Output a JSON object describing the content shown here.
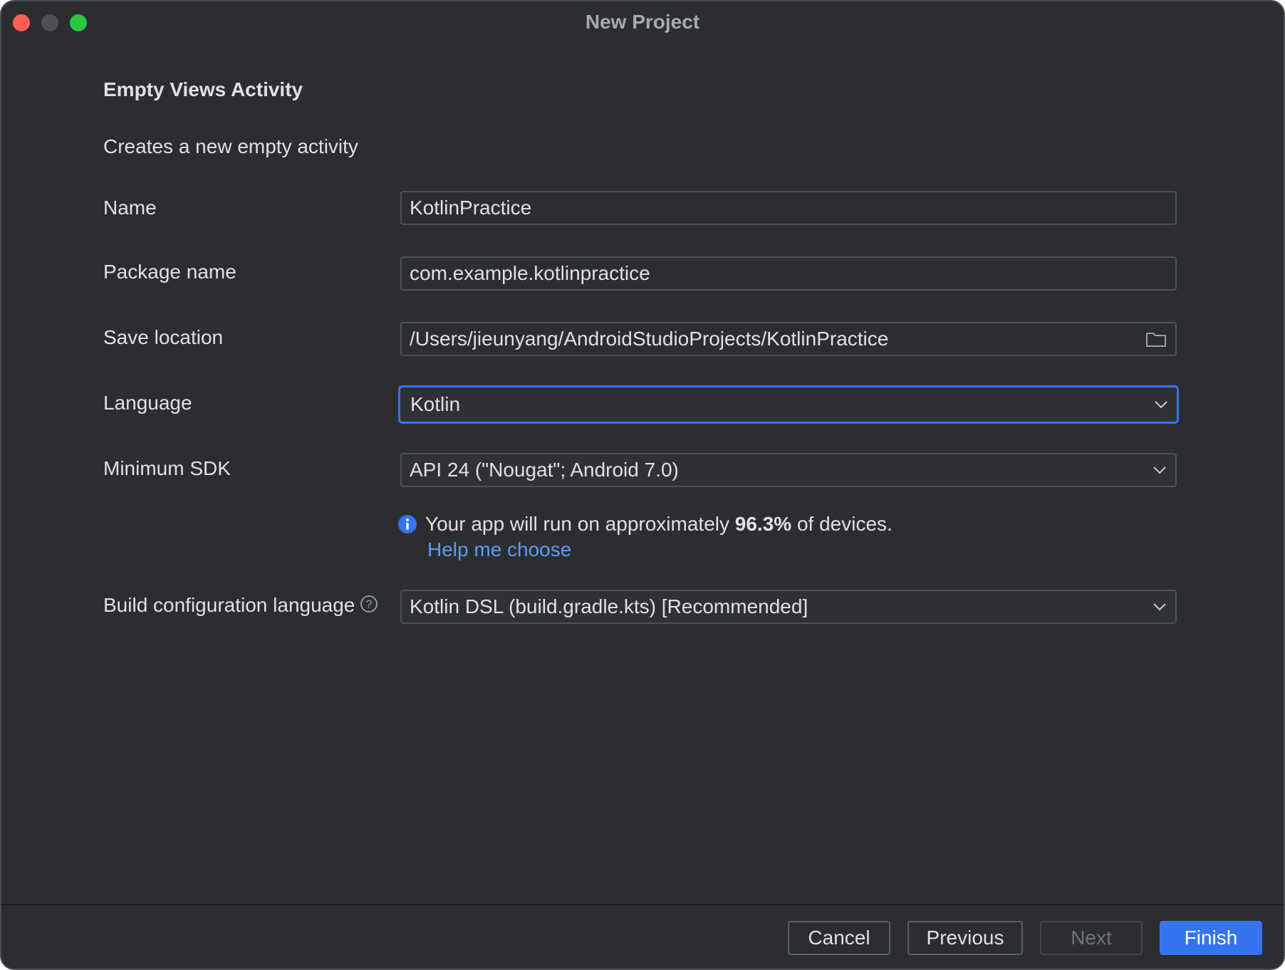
{
  "window": {
    "title": "New Project"
  },
  "header": {
    "heading": "Empty Views Activity",
    "description": "Creates a new empty activity"
  },
  "form": {
    "name": {
      "label": "Name",
      "value": "KotlinPractice"
    },
    "package_name": {
      "label": "Package name",
      "value": "com.example.kotlinpractice"
    },
    "save_location": {
      "label": "Save location",
      "value": "/Users/jieunyang/AndroidStudioProjects/KotlinPractice",
      "icon": "folder-icon"
    },
    "language": {
      "label": "Language",
      "value": "Kotlin"
    },
    "minimum_sdk": {
      "label": "Minimum SDK",
      "value": "API 24 (\"Nougat\"; Android 7.0)"
    },
    "info": {
      "prefix": "Your app will run on approximately ",
      "percentage": "96.3%",
      "suffix": " of devices.",
      "link": "Help me choose",
      "icon": "info-icon"
    },
    "build_config": {
      "label": "Build configuration language",
      "value": "Kotlin DSL (build.gradle.kts) [Recommended]",
      "help_icon": "question-mark-icon"
    }
  },
  "footer": {
    "cancel": "Cancel",
    "previous": "Previous",
    "next": "Next",
    "finish": "Finish"
  },
  "colors": {
    "background": "#2b2d30",
    "accent": "#3574f0",
    "link": "#5a9cf8",
    "text": "#dfe1e5"
  }
}
